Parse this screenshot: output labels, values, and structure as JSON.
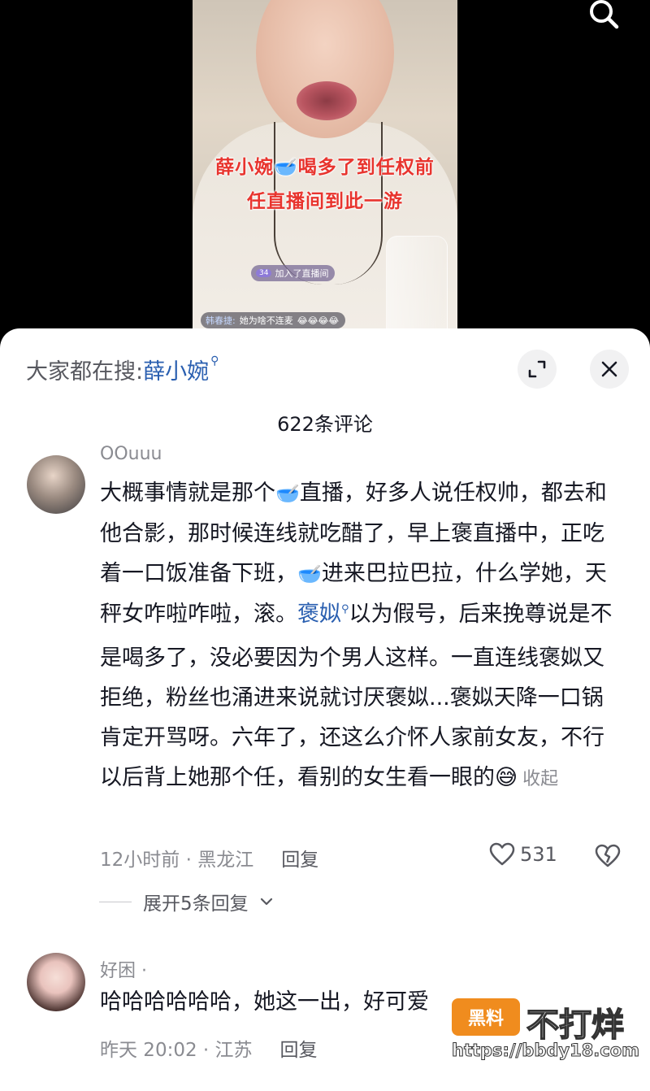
{
  "video": {
    "overlay_line1": "薛小婉🥣喝多了到任权前",
    "overlay_line2": "任直播间到此一游",
    "join_level": "34",
    "join_text": "加入了直播间",
    "chat_name": "韩春捷:",
    "chat_text": "她为啥不连麦",
    "chat_emojis": "😂😂😂😂"
  },
  "sheet": {
    "search_prefix": "大家都在搜:",
    "search_keyword": "薛小婉",
    "comment_count": "622条评论"
  },
  "comments": [
    {
      "username": "OOuuu",
      "text_part1": "大概事情就是那个",
      "emoji_a": "🥣",
      "text_part2": "直播，好多人说任权帅，都去和他合影，那时候连线就吃醋了，早上褒直播中，正吃着一口饭准备下班，",
      "emoji_b": "🥣",
      "text_part3": "进来巴拉巴拉，什么学她，天秤女咋啦咋啦，滚。",
      "link_text": "褒姒",
      "text_part4": "以为假号，后来挽尊说是不是喝多了，没必要因为个男人这样。一直连线褒姒又拒绝，粉丝也涌进来说就讨厌褒姒...褒姒天降一口锅肯定开骂呀。六年了，还这么介怀人家前女友，不行以后背上她那个任，看别的女生看一眼的",
      "emoji_c": "😅",
      "collapse": "收起",
      "time_location": "12小时前 · 黑龙江",
      "reply": "回复",
      "likes": "531",
      "expand_replies": "展开5条回复"
    },
    {
      "username": "好困 ·",
      "text": "哈哈哈哈哈哈，她这一出，好可爱",
      "time_location": "昨天 20:02 · 江苏",
      "reply": "回复"
    }
  ],
  "watermark": {
    "badge": "黑料",
    "text": "不打烊",
    "url": "https://bbdy18.com"
  }
}
